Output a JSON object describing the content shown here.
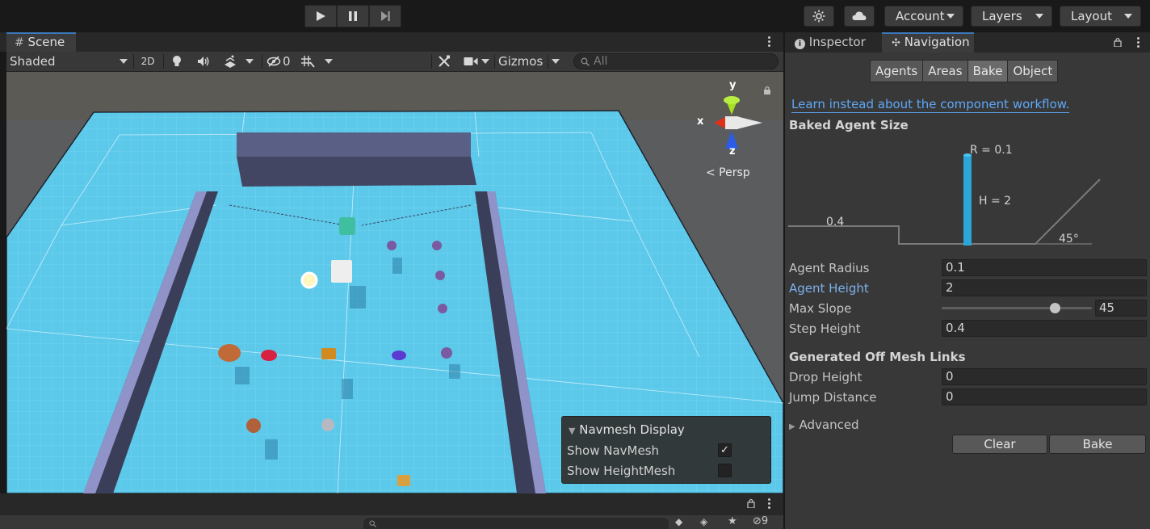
{
  "toolbar": {
    "account_label": "Account",
    "layers_label": "Layers",
    "layout_label": "Layout"
  },
  "scene": {
    "tab_label": "Scene",
    "shading_mode": "Shaded",
    "mode_2d": "2D",
    "hidden_count": "0",
    "gizmos_label": "Gizmos",
    "search_placeholder": "All",
    "persp_label": "< Persp",
    "axis_x": "x",
    "axis_y": "y",
    "axis_z": "z"
  },
  "nav_overlay": {
    "title": "Navmesh Display",
    "show_navmesh_label": "Show NavMesh",
    "show_navmesh_checked": true,
    "show_heightmesh_label": "Show HeightMesh",
    "show_heightmesh_checked": false
  },
  "inspector": {
    "tabs": [
      {
        "label": "Inspector",
        "icon": "info-icon"
      },
      {
        "label": "Navigation",
        "icon": "navigation-icon"
      }
    ],
    "segments": [
      {
        "label": "Agents",
        "active": false
      },
      {
        "label": "Areas",
        "active": false
      },
      {
        "label": "Bake",
        "active": true
      },
      {
        "label": "Object",
        "active": false
      }
    ],
    "component_link": "Learn instead about the component workflow.",
    "baked_agent_title": "Baked Agent Size",
    "diagram": {
      "radius_label": "R = 0.1",
      "height_label": "H = 2",
      "step_label": "0.4",
      "slope_label": "45°"
    },
    "properties": [
      {
        "label": "Agent Radius",
        "value": "0.1"
      },
      {
        "label": "Agent Height",
        "value": "2"
      },
      {
        "label": "Max Slope",
        "value": "45"
      },
      {
        "label": "Step Height",
        "value": "0.4"
      }
    ],
    "max_slope_fraction": 0.75,
    "offmesh_title": "Generated Off Mesh Links",
    "offmesh_properties": [
      {
        "label": "Drop Height",
        "value": "0"
      },
      {
        "label": "Jump Distance",
        "value": "0"
      }
    ],
    "advanced_label": "Advanced",
    "clear_label": "Clear",
    "bake_label": "Bake"
  },
  "bottom": {
    "hidden_count": "9"
  },
  "colors": {
    "navmesh": "#5fd0ef",
    "wall": "#3c3f5a",
    "accent": "#3a79bb",
    "link": "#5fa8f6"
  }
}
